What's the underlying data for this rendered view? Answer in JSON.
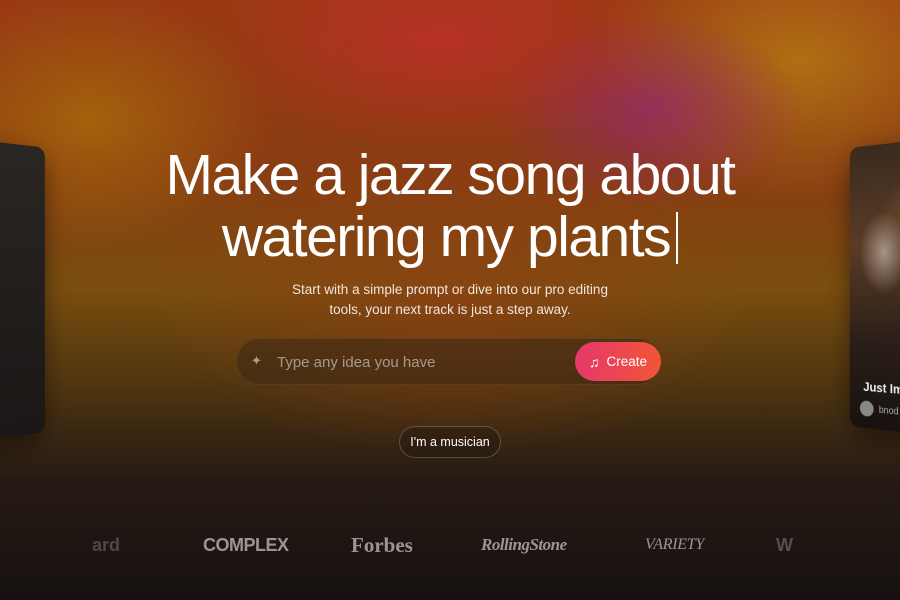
{
  "hero": {
    "headline_line1": "Make a jazz song about",
    "headline_line2": "watering my plants",
    "subtitle_line1": "Start with a simple prompt or dive into our pro editing",
    "subtitle_line2": "tools, your next track is just a step away."
  },
  "prompt": {
    "placeholder": "Type any idea you have",
    "create_label": "Create",
    "sparkle_icon": "sparkle-icon",
    "create_icon": "music-note-icon"
  },
  "musician_button_label": "I'm a musician",
  "right_card": {
    "title": "Just Ima",
    "user": "bnod"
  },
  "press_logos": [
    "ard",
    "COMPLEX",
    "Forbes",
    "RollingStone",
    "VARIETY",
    "W"
  ],
  "colors": {
    "create_gradient_start": "#e5396b",
    "create_gradient_end": "#f25437"
  }
}
